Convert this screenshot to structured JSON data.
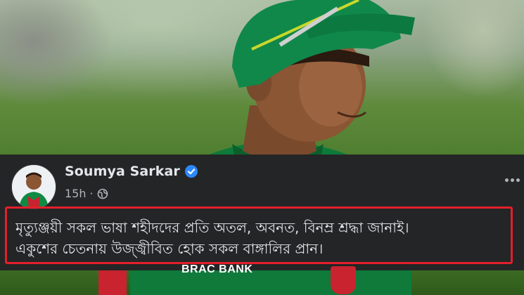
{
  "post": {
    "author_name": "Soumya Sarkar",
    "timestamp": "15h",
    "separator": "·",
    "text_lines": [
      "মৃত্যুঞ্জয়ী সকল ভাষা শহীদদের প্রতি অতল, অবনত, বিনম্র শ্রদ্ধা জানাই।",
      "একুশের চেতনায় উজ্জ্বীবিত হোক সকল বাঙ্গালির প্রান।"
    ]
  },
  "jersey": {
    "sponsor_text": "BRAC BANK"
  },
  "colors": {
    "card_bg": "#242526",
    "text_primary": "#e4e6eb",
    "text_secondary": "#b0b3b8",
    "verified_blue": "#2d88ff",
    "highlight_border": "#e3202b"
  },
  "icons": [
    "verified-badge-icon",
    "globe-icon",
    "more-options-icon"
  ]
}
